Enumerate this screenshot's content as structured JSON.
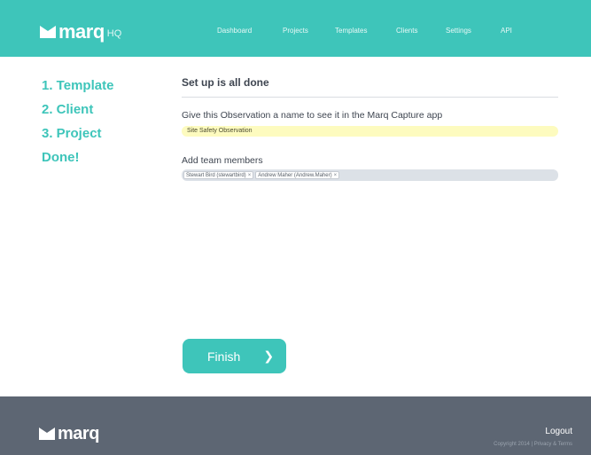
{
  "header": {
    "logo_text": "marq",
    "logo_suffix": "HQ",
    "nav": [
      {
        "label": "Dashboard"
      },
      {
        "label": "Projects"
      },
      {
        "label": "Templates"
      },
      {
        "label": "Clients"
      },
      {
        "label": "Settings"
      },
      {
        "label": "API"
      }
    ]
  },
  "steps": [
    {
      "label": "1. Template"
    },
    {
      "label": "2. Client"
    },
    {
      "label": "3. Project"
    },
    {
      "label": "Done!"
    }
  ],
  "main": {
    "title": "Set up is all done",
    "name_label": "Give this Observation a name to see it in the Marq Capture app",
    "name_value": "Site Safety Observation",
    "team_label": "Add team members",
    "team_members": [
      {
        "label": "Stewart Bird (stewartbird)"
      },
      {
        "label": "Andrew Maher (Andrew.Maher)"
      }
    ],
    "tag_remove": "×"
  },
  "finish": {
    "label": "Finish",
    "arrow": "❯"
  },
  "footer": {
    "logo_text": "marq",
    "logout": "Logout",
    "copyright": "Copyright 2014 | ",
    "privacy_terms": "Privacy & Terms"
  },
  "colors": {
    "brand": "#3ec5ba",
    "footer_bg": "#5d6673",
    "input_highlight": "#fdfbbf"
  },
  "icons": {
    "logo_mark": "m-chevron-icon",
    "finish_arrow": "chevron-right-icon",
    "tag_remove": "close-icon"
  }
}
